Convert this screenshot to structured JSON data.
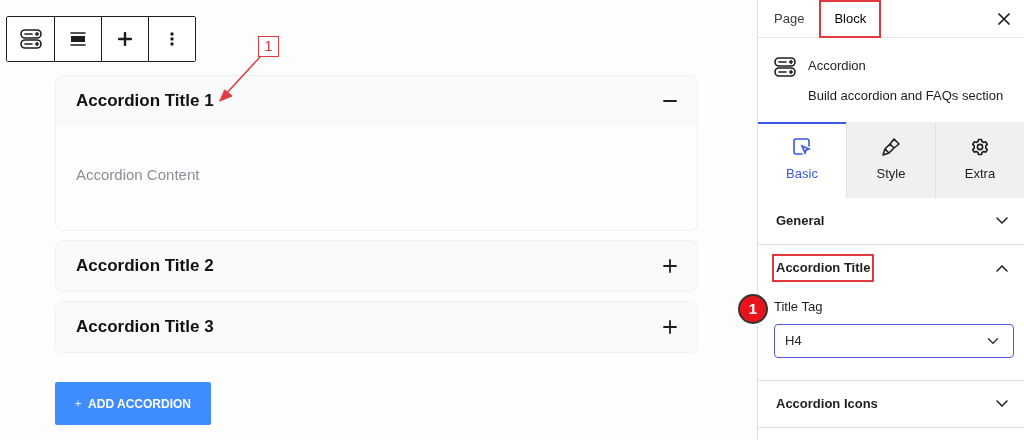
{
  "editor": {
    "toolbar": [
      {
        "kind": "block"
      },
      {
        "kind": "align"
      },
      {
        "kind": "add"
      },
      {
        "kind": "more"
      }
    ],
    "accordion": [
      {
        "title": "Accordion Title 1",
        "expanded": true,
        "content": "Accordion Content"
      },
      {
        "title": "Accordion Title 2",
        "expanded": false
      },
      {
        "title": "Accordion Title 3",
        "expanded": false
      }
    ],
    "add_button": "ADD ACCORDION"
  },
  "sidebar": {
    "tabs": [
      {
        "label": "Page",
        "selected": false,
        "highlighted": false
      },
      {
        "label": "Block",
        "selected": true,
        "highlighted": true
      }
    ],
    "block": {
      "name": "Accordion",
      "description": "Build accordion and FAQs section"
    },
    "panel_tabs": [
      {
        "label": "Basic",
        "selected": true
      },
      {
        "label": "Style",
        "selected": false
      },
      {
        "label": "Extra",
        "selected": false
      }
    ],
    "sections": [
      {
        "title": "General",
        "expanded": false,
        "highlighted": false
      },
      {
        "title": "Accordion Title",
        "expanded": true,
        "highlighted": true,
        "fields": [
          {
            "label": "Title Tag",
            "value": "H4"
          }
        ]
      },
      {
        "title": "Accordion Icons",
        "expanded": false,
        "highlighted": false
      }
    ]
  },
  "annotations": {
    "callout_number": "1",
    "step_badge": "1"
  }
}
